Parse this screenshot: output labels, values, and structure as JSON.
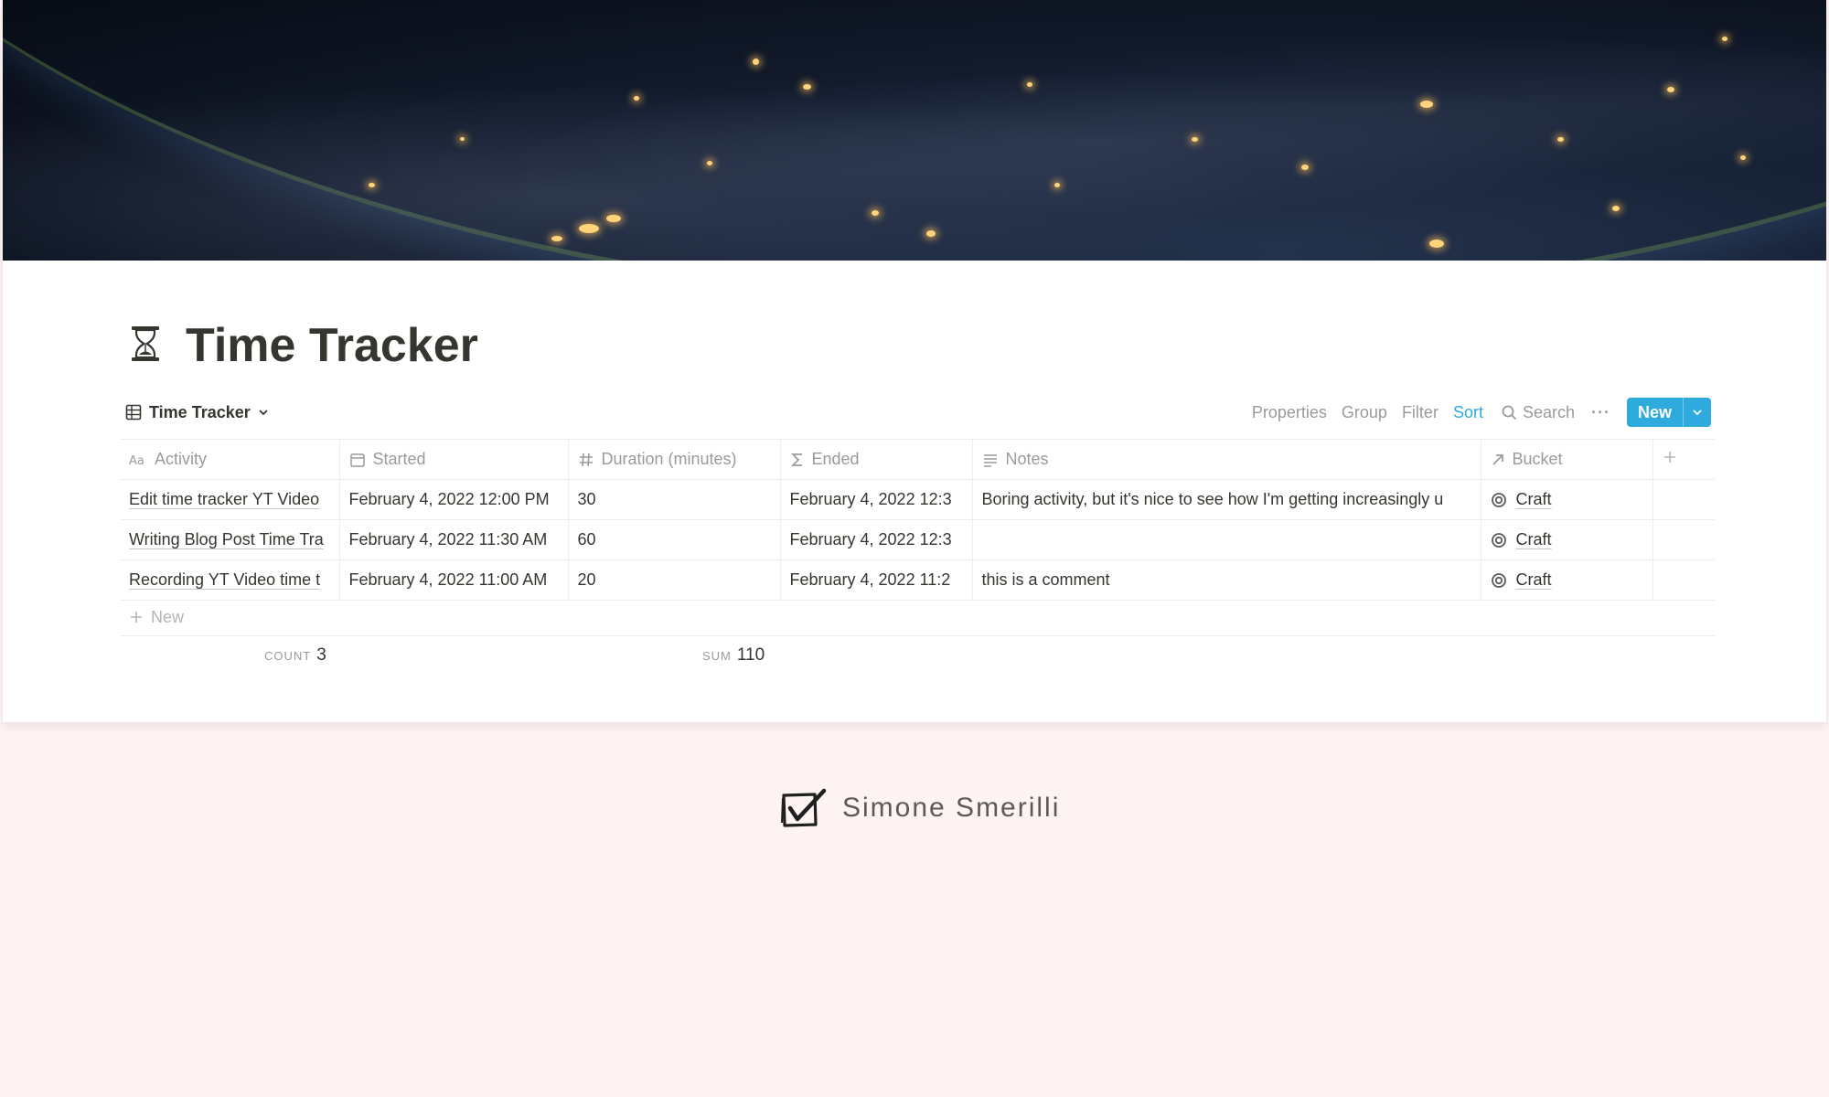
{
  "page": {
    "title": "Time Tracker",
    "icon": "hourglass-icon"
  },
  "view": {
    "label": "Time Tracker",
    "icon": "table-icon"
  },
  "toolbar": {
    "properties": "Properties",
    "group": "Group",
    "filter": "Filter",
    "sort": "Sort",
    "search": "Search",
    "more": "···",
    "new": "New",
    "accent_color": "#2eaadc"
  },
  "table": {
    "columns": [
      {
        "label": "Activity",
        "icon": "text-aa-icon"
      },
      {
        "label": "Started",
        "icon": "calendar-icon"
      },
      {
        "label": "Duration (minutes)",
        "icon": "hash-icon"
      },
      {
        "label": "Ended",
        "icon": "formula-sigma-icon"
      },
      {
        "label": "Notes",
        "icon": "text-lines-icon"
      },
      {
        "label": "Bucket",
        "icon": "relation-arrow-icon"
      }
    ],
    "rows": [
      {
        "activity": "Edit time tracker YT Video",
        "started": "February 4, 2022 12:00 PM",
        "duration": "30",
        "ended": "February 4, 2022 12:3",
        "notes": "Boring activity, but it's nice to see how I'm getting increasingly u",
        "bucket": "Craft"
      },
      {
        "activity": "Writing Blog Post Time Tra",
        "started": "February 4, 2022 11:30 AM",
        "duration": "60",
        "ended": "February 4, 2022 12:3",
        "notes": "",
        "bucket": "Craft"
      },
      {
        "activity": "Recording YT Video time t",
        "started": "February 4, 2022 11:00 AM",
        "duration": "20",
        "ended": "February 4, 2022 11:2",
        "notes": "this is a comment",
        "bucket": "Craft"
      }
    ],
    "new_row": "New",
    "calc": {
      "count_label": "COUNT",
      "count_value": "3",
      "sum_label": "SUM",
      "sum_value": "110"
    }
  },
  "footer": {
    "name": "Simone Smerilli",
    "logo": "checkbox-logo-icon"
  }
}
